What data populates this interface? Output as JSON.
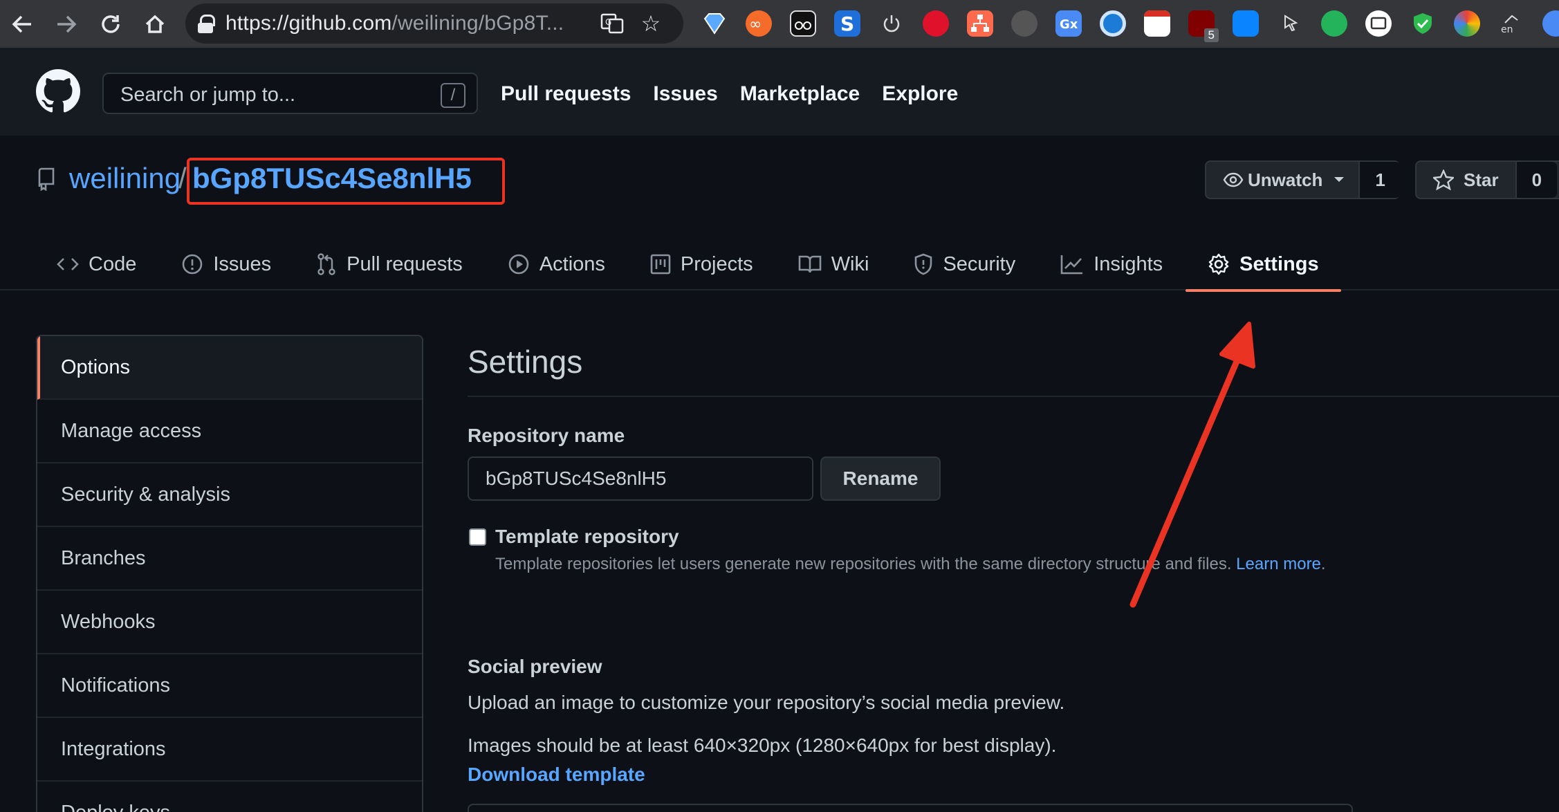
{
  "browser": {
    "url_host": "https://github.com",
    "url_path": "/weilining/bGp8T...",
    "extension_badge": "5"
  },
  "header": {
    "search_placeholder": "Search or jump to...",
    "search_shortcut": "/",
    "nav": [
      "Pull requests",
      "Issues",
      "Marketplace",
      "Explore"
    ]
  },
  "repo": {
    "owner": "weilining",
    "separator": "/",
    "name": "bGp8TUSc4Se8nlH5",
    "watch_label": "Unwatch",
    "watch_count": "1",
    "star_label": "Star",
    "star_count": "0"
  },
  "tabs": [
    {
      "label": "Code",
      "icon": "code-icon"
    },
    {
      "label": "Issues",
      "icon": "issue-icon"
    },
    {
      "label": "Pull requests",
      "icon": "pull-request-icon"
    },
    {
      "label": "Actions",
      "icon": "play-icon"
    },
    {
      "label": "Projects",
      "icon": "project-icon"
    },
    {
      "label": "Wiki",
      "icon": "book-icon"
    },
    {
      "label": "Security",
      "icon": "shield-icon"
    },
    {
      "label": "Insights",
      "icon": "graph-icon"
    },
    {
      "label": "Settings",
      "icon": "gear-icon",
      "active": true
    }
  ],
  "sidebar": {
    "items": [
      "Options",
      "Manage access",
      "Security & analysis",
      "Branches",
      "Webhooks",
      "Notifications",
      "Integrations",
      "Deploy keys"
    ],
    "selected": "Options"
  },
  "main": {
    "title": "Settings",
    "repo_name_label": "Repository name",
    "repo_name_value": "bGp8TUSc4Se8nlH5",
    "rename_label": "Rename",
    "template_label": "Template repository",
    "template_help": "Template repositories let users generate new repositories with the same directory structure and files.",
    "learn_more": "Learn more",
    "social_label": "Social preview",
    "social_desc": "Upload an image to customize your repository’s social media preview.",
    "social_size": "Images should be at least 640×320px (1280×640px for best display).",
    "download_template": "Download template"
  },
  "colors": {
    "accent_tab": "#f78166",
    "link": "#58a6ff",
    "annotation": "#ea3323",
    "background": "#0d1117"
  }
}
